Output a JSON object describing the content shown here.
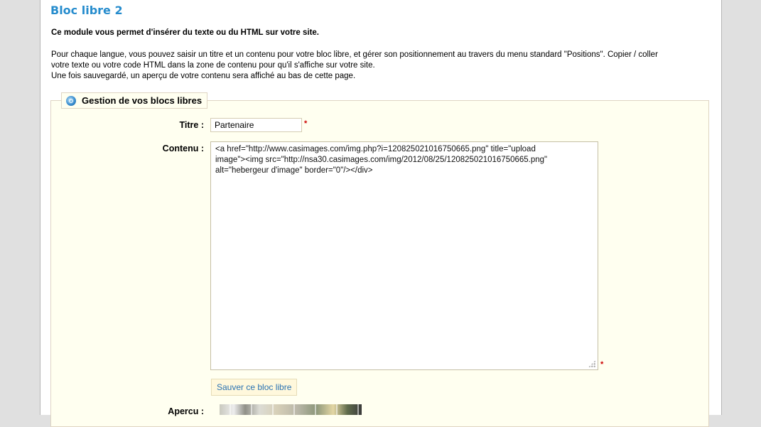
{
  "page": {
    "title": "Bloc libre 2",
    "intro_bold": "Ce module vous permet d'insérer du texte ou du HTML sur votre site.",
    "intro_lines": [
      "Pour chaque langue, vous pouvez saisir un titre et un contenu pour votre bloc libre, et gérer son positionnement au travers du menu standard \"Positions\". Copier / coller",
      "votre texte ou votre code HTML dans la zone de contenu pour qu'il s'affiche sur votre site.",
      "Une fois sauvegardé, un aperçu de votre contenu sera affiché au bas de cette page."
    ]
  },
  "form": {
    "legend": "Gestion de vos blocs libres",
    "legend_icon": "logo-icon",
    "titre_label": "Titre :",
    "titre_value": "Partenaire",
    "required_mark": "*",
    "contenu_label": "Contenu :",
    "contenu_lines": [
      "<a href=\"http://www.casimages.com/img.php?i=120825021016750665.png\" title=\"upload",
      "image\"><img src=\"http://nsa30.casimages.com/img/2012/08/25/120825021016750665.png\"",
      "alt=\"hebergeur d'image\" border=\"0\"/></div>"
    ],
    "save_button": "Sauver ce bloc libre",
    "apercu_label": "Apercu :"
  },
  "colors": {
    "title": "#268ccd",
    "fieldset_bg": "#fffff0",
    "button_text": "#2a72b2",
    "required": "#cc0000"
  }
}
